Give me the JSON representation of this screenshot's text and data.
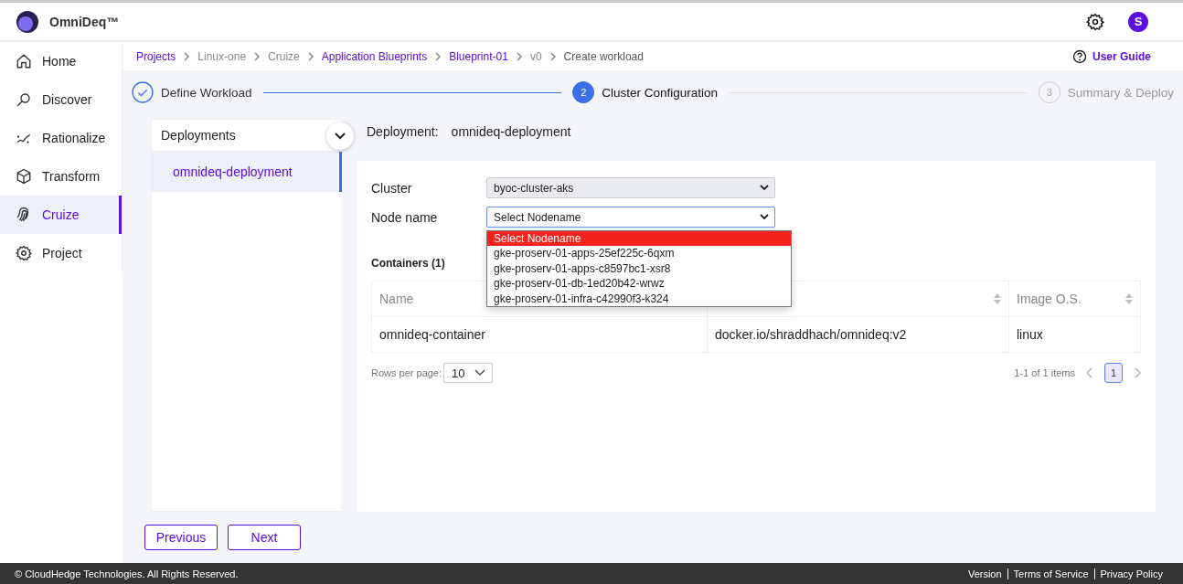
{
  "app": {
    "name": "OmniDeq™",
    "avatar": "S"
  },
  "sidebar": {
    "items": [
      {
        "label": "Home",
        "selected": false
      },
      {
        "label": "Discover",
        "selected": false
      },
      {
        "label": "Rationalize",
        "selected": false
      },
      {
        "label": "Transform",
        "selected": false
      },
      {
        "label": "Cruize",
        "selected": true
      },
      {
        "label": "Project",
        "selected": false
      }
    ]
  },
  "breadcrumbs": [
    {
      "label": "Projects",
      "link": true
    },
    {
      "label": "Linux-one",
      "link": false
    },
    {
      "label": "Cruize",
      "link": false
    },
    {
      "label": "Application Blueprints",
      "link": true
    },
    {
      "label": "Blueprint-01",
      "link": true
    },
    {
      "label": "v0",
      "link": false
    },
    {
      "label": "Create workload",
      "link": false,
      "current": true
    }
  ],
  "user_guide": "User Guide",
  "steps": [
    {
      "label": "Define Workload",
      "completed": true,
      "selected": false
    },
    {
      "number": "2",
      "label": "Cluster Configuration",
      "completed": false,
      "selected": true
    },
    {
      "number": "3",
      "label": "Summary & Deploy",
      "completed": false,
      "selected": false
    }
  ],
  "deployments": {
    "title": "Deployments",
    "items": [
      {
        "label": "omnideq-deployment",
        "selected": true
      }
    ]
  },
  "deployment": {
    "label": "Deployment:",
    "value": "omnideq-deployment"
  },
  "form": {
    "cluster": {
      "label": "Cluster",
      "value": "byoc-cluster-aks",
      "disabled": true
    },
    "node": {
      "label": "Node name",
      "value": "Select Nodename",
      "expanded": true,
      "options": [
        {
          "label": "Select Nodename",
          "selected": true
        },
        {
          "label": "gke-proserv-01-apps-25ef225c-6qxm",
          "selected": false
        },
        {
          "label": "gke-proserv-01-apps-c8597bc1-xsr8",
          "selected": false
        },
        {
          "label": "gke-proserv-01-db-1ed20b42-wrwz",
          "selected": false
        },
        {
          "label": "gke-proserv-01-infra-c42990f3-k324",
          "selected": false
        }
      ]
    }
  },
  "containers": {
    "title": "Containers (1)",
    "columns": [
      {
        "label": "Name"
      },
      {},
      {
        "label": "Image O.S."
      }
    ],
    "rows": [
      [
        "omnideq-container",
        "docker.io/shraddhach/omnideq:v2",
        "linux"
      ]
    ],
    "rows_per_page_label": "Rows per page:",
    "rows_per_page": "10",
    "range": "1-1 of 1 items",
    "pages": [
      {
        "label": "1",
        "selected": true
      }
    ]
  },
  "buttons": [
    {
      "label": "Previous"
    },
    {
      "label": "Next"
    }
  ],
  "footer": {
    "copyright": "© CloudHedge Technologies. All Rights Reserved.",
    "links": [
      "Version",
      "Terms of Service",
      "Privacy Policy"
    ]
  }
}
